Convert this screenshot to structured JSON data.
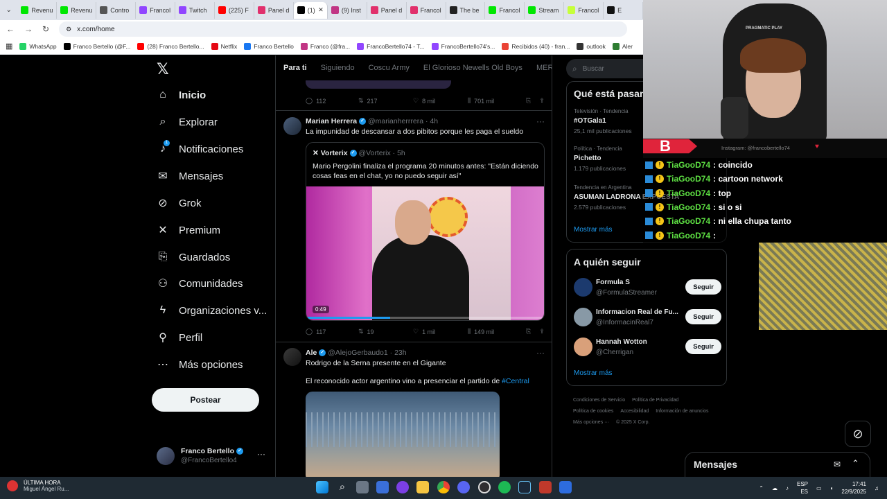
{
  "browser": {
    "tabs": [
      {
        "label": "Revenu",
        "color": "#00e701"
      },
      {
        "label": "Revenu",
        "color": "#00e701"
      },
      {
        "label": "Contro",
        "color": "#555555"
      },
      {
        "label": "Francol",
        "color": "#9146ff"
      },
      {
        "label": "Twitch",
        "color": "#9146ff"
      },
      {
        "label": "(225) F",
        "color": "#ff0000"
      },
      {
        "label": "Panel d",
        "color": "#e1306c"
      },
      {
        "label": "(1)",
        "color": "#000000",
        "active": true
      },
      {
        "label": "(9) Inst",
        "color": "#c13584"
      },
      {
        "label": "Panel d",
        "color": "#e1306c"
      },
      {
        "label": "Francol",
        "color": "#e1306c"
      },
      {
        "label": "The be",
        "color": "#222222"
      },
      {
        "label": "Francol",
        "color": "#00e701"
      },
      {
        "label": "Stream",
        "color": "#00e701"
      },
      {
        "label": "Francol",
        "color": "#c6ff3a"
      },
      {
        "label": "E",
        "color": "#111111"
      }
    ],
    "url": "x.com/home",
    "bookmarks": [
      {
        "label": "WhatsApp",
        "color": "#25d366"
      },
      {
        "label": "Franco Bertello (@F...",
        "color": "#000000"
      },
      {
        "label": "(28) Franco Bertello...",
        "color": "#ff0000"
      },
      {
        "label": "Netflix",
        "color": "#e50914"
      },
      {
        "label": "Franco Bertello",
        "color": "#1877f2"
      },
      {
        "label": "Franco (@fra...",
        "color": "#c13584"
      },
      {
        "label": "FrancoBertello74 - T...",
        "color": "#9146ff"
      },
      {
        "label": "FrancoBertello74's...",
        "color": "#9146ff"
      },
      {
        "label": "Recibidos (40) - fran...",
        "color": "#ea4335"
      },
      {
        "label": "outlook",
        "color": "#333333"
      },
      {
        "label": "Aler",
        "color": "#2e7d32"
      }
    ]
  },
  "nav": {
    "items": [
      {
        "label": "Inicio",
        "icon": "home-icon",
        "glyph": "⌂"
      },
      {
        "label": "Explorar",
        "icon": "search-icon",
        "glyph": "⌕"
      },
      {
        "label": "Notificaciones",
        "icon": "bell-icon",
        "glyph": "♪"
      },
      {
        "label": "Mensajes",
        "icon": "mail-icon",
        "glyph": "✉"
      },
      {
        "label": "Grok",
        "icon": "grok-icon",
        "glyph": "⊘"
      },
      {
        "label": "Premium",
        "icon": "x-icon",
        "glyph": "✕"
      },
      {
        "label": "Guardados",
        "icon": "bookmark-icon",
        "glyph": "⎘"
      },
      {
        "label": "Comunidades",
        "icon": "people-icon",
        "glyph": "⚇"
      },
      {
        "label": "Organizaciones v...",
        "icon": "bolt-icon",
        "glyph": "ϟ"
      },
      {
        "label": "Perfil",
        "icon": "person-icon",
        "glyph": "⚲"
      },
      {
        "label": "Más opciones",
        "icon": "more-circle-icon",
        "glyph": "⋯"
      }
    ],
    "notification_badge": "1",
    "post_label": "Postear",
    "profile_name": "Franco Bertello",
    "profile_handle": "@FrancoBertello4"
  },
  "timeline": {
    "tabs": [
      "Para ti",
      "Siguiendo",
      "Coscu Army",
      "El Glorioso Newells Old Boys",
      "MERNC"
    ],
    "prev_actions": {
      "replies": "112",
      "reposts": "217",
      "likes": "8 mil",
      "views": "701 mil"
    },
    "tweet1": {
      "name": "Marian Herrera",
      "handle": "@marianherrrera",
      "time": "4h",
      "text": "La impunidad de descansar a dos pibitos porque les paga el sueldo",
      "quote_name": "Vorterix",
      "quote_handle": "@Vorterix",
      "quote_time": "5h",
      "quote_text": "Mario Pergolini finaliza el programa 20 minutos antes: \"Están diciendo cosas feas en el chat, yo no puedo seguir así\"",
      "video_time": "0:49",
      "actions": {
        "replies": "117",
        "reposts": "19",
        "likes": "1 mil",
        "views": "149 mil"
      }
    },
    "tweet2": {
      "name": "Ale",
      "handle": "@AlejoGerbaudo1",
      "time": "23h",
      "text1": "Rodrigo de la Serna presente en el Gigante",
      "text2": "El reconocido actor argentino vino a presenciar el partido de",
      "hashtag": "#Central"
    }
  },
  "right": {
    "search_placeholder": "Buscar",
    "trends_title": "Qué está pasan",
    "trends": [
      {
        "cat": "Televisión · Tendencia",
        "name": "#OTGala1",
        "count": "25,1 mil publicaciones"
      },
      {
        "cat": "Política · Tendencia",
        "name": "Pichetto",
        "count": "1.179 publicaciones"
      },
      {
        "cat": "Tendencia en Argentina",
        "name": "ASUMAN LADRONA EXPUESTA",
        "count": "2.579 publicaciones"
      }
    ],
    "show_more": "Mostrar más",
    "follow_title": "A quién seguir",
    "follow": [
      {
        "name": "Formula S",
        "handle": "@FormulaStreamer",
        "color": "#1c3a6e"
      },
      {
        "name": "Informacion Real de Fu...",
        "handle": "@InformacinReal7",
        "color": "#8899a6"
      },
      {
        "name": "Hannah Wotton",
        "handle": "@Cherrigan",
        "color": "#d9a07a"
      }
    ],
    "follow_btn": "Seguir",
    "footer": [
      "Condiciones de Servicio",
      "Política de Privacidad",
      "Política de cookies",
      "Accesibilidad",
      "Información de anuncios",
      "Más opciones ···",
      "© 2025 X Corp."
    ]
  },
  "messages_label": "Mensajes",
  "stream": {
    "instagram": "Instagram: @francobertello74",
    "cam_brand": "PRAGMATIC PLAY",
    "chat": [
      {
        "user": "TiaGooD74",
        "msg": ": coincido"
      },
      {
        "user": "TiaGooD74",
        "msg": ": cartoon network"
      },
      {
        "user": "TiaGooD74",
        "msg": ": top"
      },
      {
        "user": "TiaGooD74",
        "msg": ": si o si"
      },
      {
        "user": "TiaGooD74",
        "msg": ": ni ella chupa tanto"
      },
      {
        "user": "TiaGooD74",
        "msg": ":"
      }
    ]
  },
  "taskbar": {
    "news_title": "ÚLTIMA HORA",
    "news_sub": "Miguel Ángel Ru...",
    "lang1": "ESP",
    "lang2": "ES",
    "time": "17:41",
    "date": "22/9/2025"
  }
}
